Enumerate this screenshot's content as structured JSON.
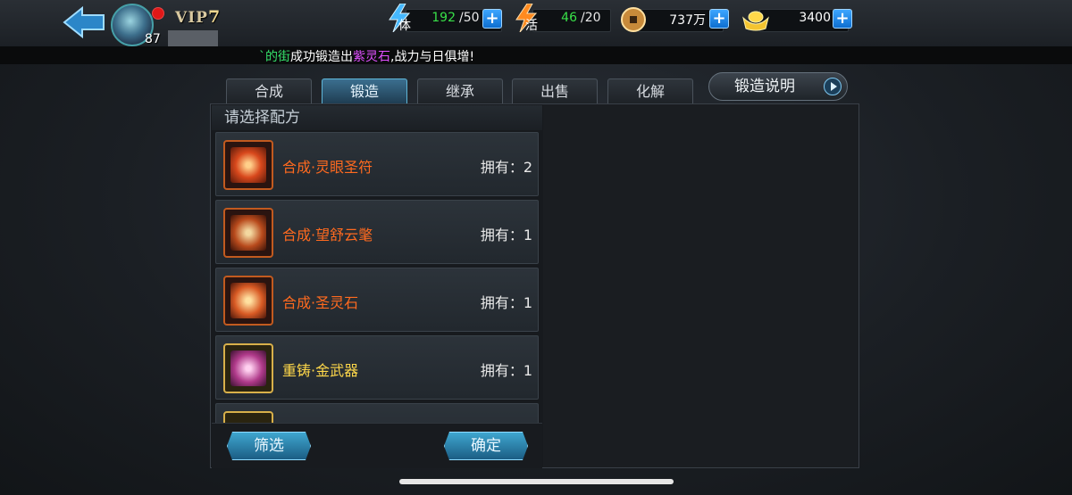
{
  "header": {
    "vip_prefix": "VIP",
    "vip_level": "7",
    "level": "87",
    "resources": [
      {
        "name": "stamina",
        "icon": "stamina-icon",
        "label": "体",
        "value": "192",
        "max": "/50",
        "color": "#38e048"
      },
      {
        "name": "energy",
        "icon": "energy-icon",
        "label": "活",
        "value": "46",
        "max": "/20",
        "color": "#38e048"
      },
      {
        "name": "coins",
        "icon": "coin-icon",
        "value": "737万",
        "color": "#ffffff"
      },
      {
        "name": "ingots",
        "icon": "ingot-icon",
        "value": "3400",
        "color": "#ffffff"
      }
    ]
  },
  "broadcast": {
    "part1": "`的街",
    "part2": "成功锻造出",
    "part3": "紫灵石",
    "part4": ",战力与日俱增!"
  },
  "tabs": [
    {
      "label": "合成",
      "active": false
    },
    {
      "label": "锻造",
      "active": true
    },
    {
      "label": "继承",
      "active": false
    },
    {
      "label": "出售",
      "active": false
    },
    {
      "label": "化解",
      "active": false
    }
  ],
  "info_button": "锻造说明",
  "list": {
    "title": "请选择配方",
    "items": [
      {
        "name": "合成·灵眼圣符",
        "owned": "拥有：2",
        "color": "#ff6a1f",
        "icon": "scroll-red-icon"
      },
      {
        "name": "合成·望舒云氅",
        "owned": "拥有：1",
        "color": "#ff6a1f",
        "icon": "scroll-red-icon"
      },
      {
        "name": "合成·圣灵石",
        "owned": "拥有：1",
        "color": "#ff6a1f",
        "icon": "scroll-red-icon"
      },
      {
        "name": "重铸·金武器",
        "owned": "拥有：1",
        "color": "#ffd84a",
        "icon": "scroll-gold-icon"
      }
    ]
  },
  "buttons": {
    "filter": "筛选",
    "confirm": "确定"
  },
  "colors": {
    "accent": "#3fa6cf",
    "orange_item": "#ff6a1f",
    "gold_item": "#ffd84a"
  }
}
